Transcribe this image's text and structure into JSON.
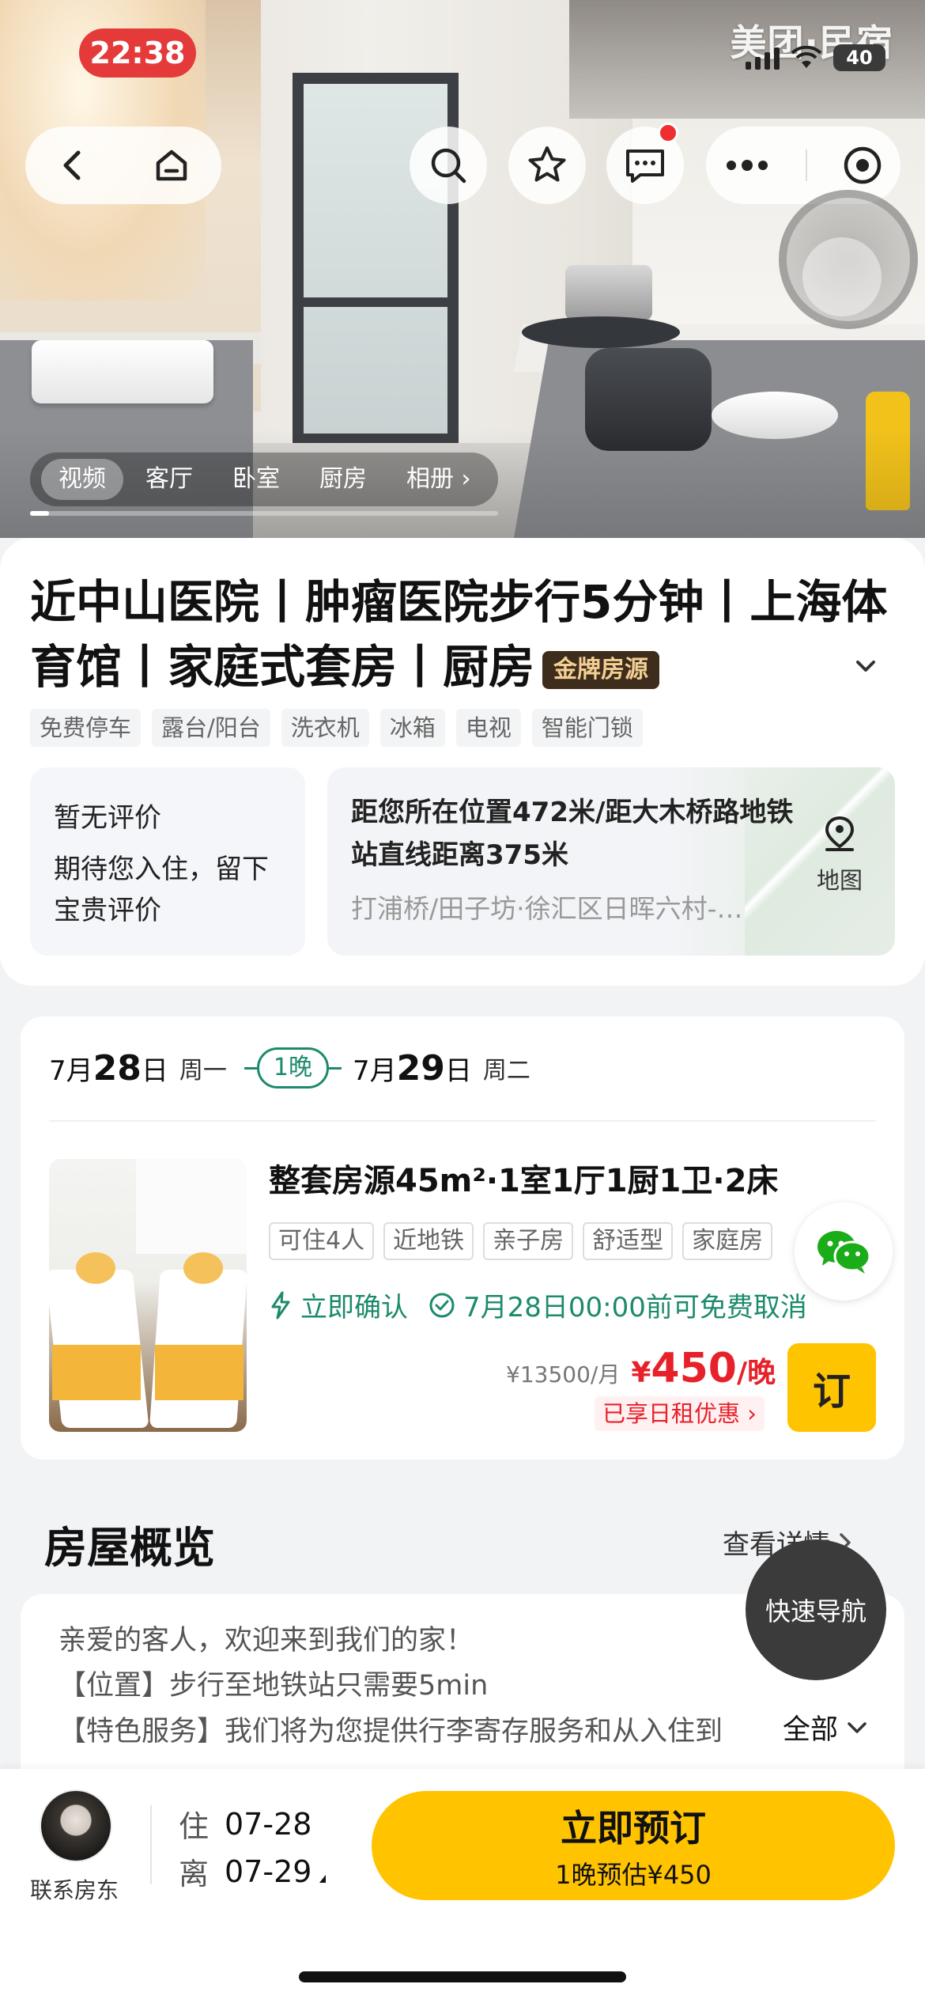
{
  "status_bar": {
    "time": "22:38",
    "brand": "美团·民宿",
    "battery": "40"
  },
  "gallery": {
    "tabs": [
      {
        "label": "视频",
        "active": true
      },
      {
        "label": "客厅",
        "active": false
      },
      {
        "label": "卧室",
        "active": false
      },
      {
        "label": "厨房",
        "active": false
      },
      {
        "label": "相册 ›",
        "active": false
      }
    ],
    "progress_fraction": 0.04
  },
  "listing": {
    "title": "近中山医院丨肿瘤医院步行5分钟丨上海体育馆丨家庭式套房丨厨房",
    "badge": "金牌房源",
    "amenities": [
      "免费停车",
      "露台/阳台",
      "洗衣机",
      "冰箱",
      "电视",
      "智能门锁"
    ]
  },
  "review": {
    "title": "暂无评价",
    "body": "期待您入住，留下宝贵评价"
  },
  "location": {
    "distance": "距您所在位置472米/距大木桥路地铁站直线距离375米",
    "address": "打浦桥/田子坊·徐汇区日晖六村-…",
    "map_label": "地图"
  },
  "booking": {
    "checkin_month_label": "7月",
    "checkin_day": "28",
    "checkin_day_suffix": "日",
    "checkin_weekday": "周一",
    "nights": "1晚",
    "checkout_month_label": "7月",
    "checkout_day": "29",
    "checkout_day_suffix": "日",
    "checkout_weekday": "周二"
  },
  "room": {
    "title": "整套房源45m²·1室1厅1厨1卫·2床",
    "tags": [
      "可住4人",
      "近地铁",
      "亲子房",
      "舒适型",
      "家庭房"
    ],
    "instant_confirm": "立即确认",
    "free_cancel": "7月28日00:00前可免费取消",
    "monthly_price": "¥13500/月",
    "price_symbol": "¥",
    "price": "450",
    "price_unit": "/晚",
    "discount": "已享日租优惠 ›",
    "book_label": "订"
  },
  "overview": {
    "title": "房屋概览",
    "more": "查看详情",
    "lines": [
      "亲爱的客人，欢迎来到我们的家！",
      "【位置】步行至地铁站只需要5min",
      "【特色服务】我们将为您提供行李寄存服务和从入住到"
    ],
    "expand": "全部",
    "quick_nav": "快速导航"
  },
  "footer": {
    "host_label": "联系房东",
    "checkin_key": "住",
    "checkin_date": "07-28",
    "checkout_key": "离",
    "checkout_date": "07-29",
    "book_label": "立即预订",
    "book_sub": "1晚预估¥450"
  },
  "colors": {
    "accent_yellow": "#ffc300",
    "price_red": "#e8202a",
    "confirm_green": "#1c8a6c",
    "badge_dark": "#3e2c1c"
  }
}
